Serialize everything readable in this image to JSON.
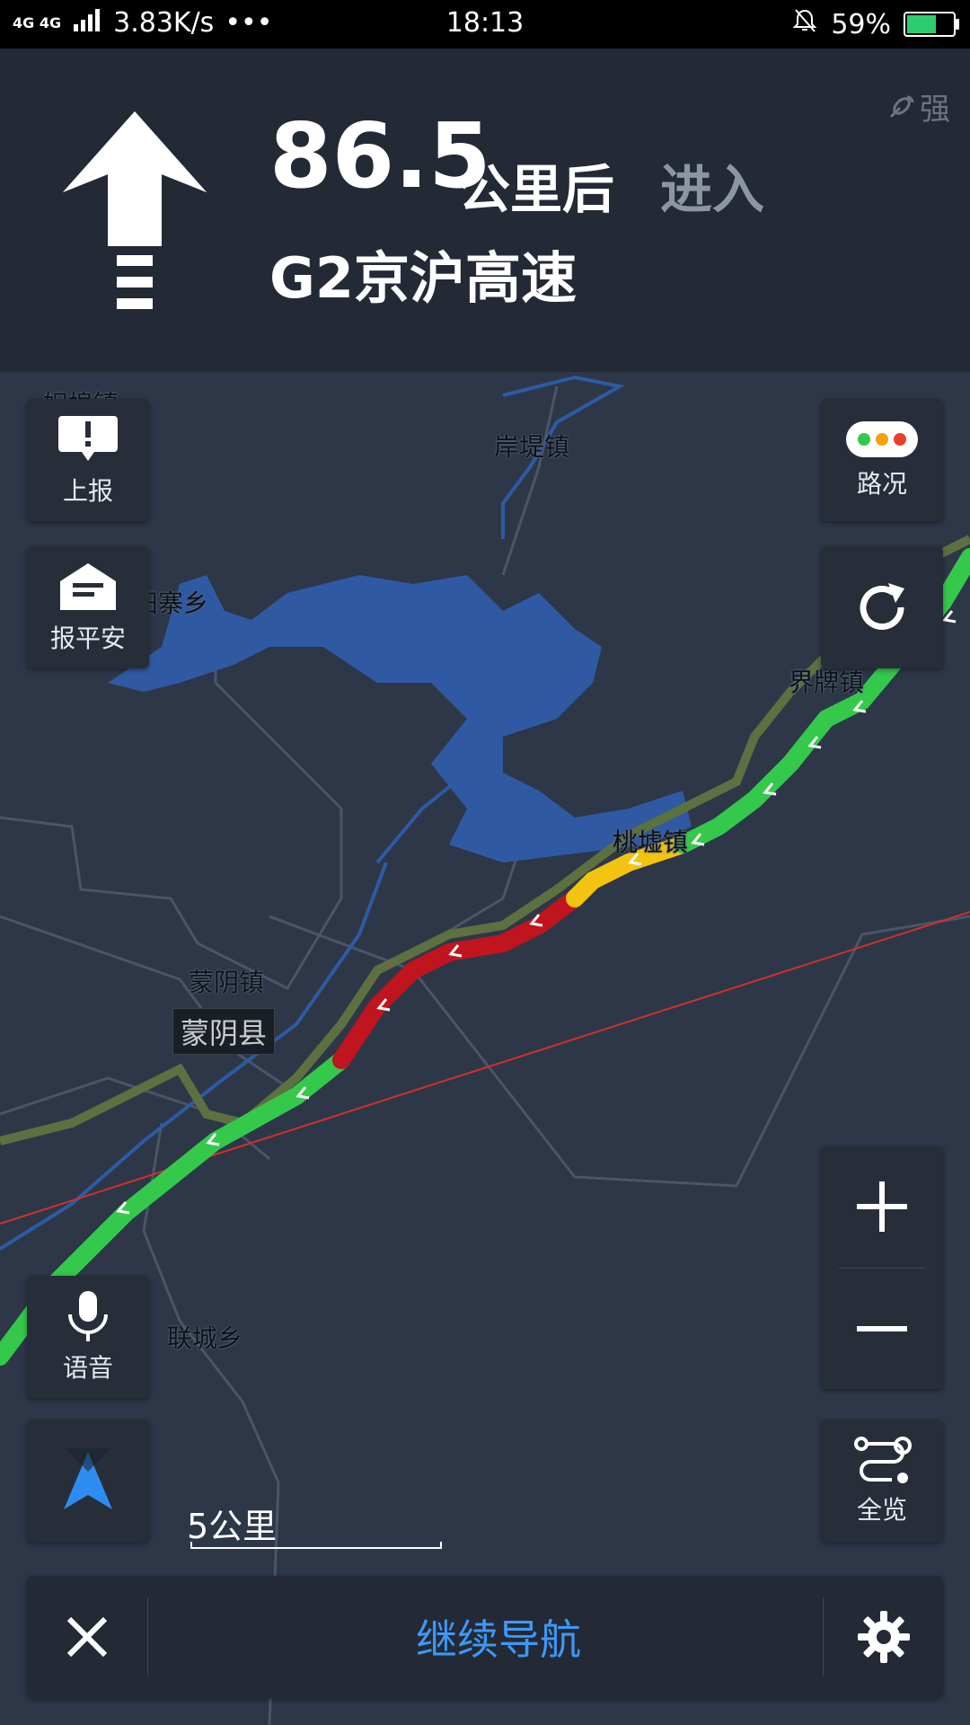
{
  "status_bar": {
    "network": "4G 4G",
    "speed": "3.83K/s",
    "more": "•••",
    "time": "18:13",
    "battery_percent": "59%",
    "battery_level": 0.59
  },
  "guidance": {
    "distance_value": "86.5",
    "distance_unit": "公里后",
    "action": "进入",
    "road_name": "G2京沪高速",
    "gps_signal": "强"
  },
  "map_labels": {
    "l1": "妲埠镇",
    "l2": "岸堤镇",
    "l3": "田寨乡",
    "l4": "界牌镇",
    "l5": "桃墟镇",
    "l6": "蒙阴镇",
    "l7": "蒙阴县",
    "l8": "联城乡"
  },
  "buttons": {
    "report": "上报",
    "safe": "报平安",
    "traffic": "路况",
    "voice": "语音",
    "overview": "全览"
  },
  "scale": "5公里",
  "bottom": {
    "continue": "继续导航"
  },
  "colors": {
    "route_green": "#34c94a",
    "route_red": "#c0141e",
    "route_yellow": "#f2c40f",
    "water": "#2f5aa3",
    "accent_blue": "#3e98f5"
  }
}
